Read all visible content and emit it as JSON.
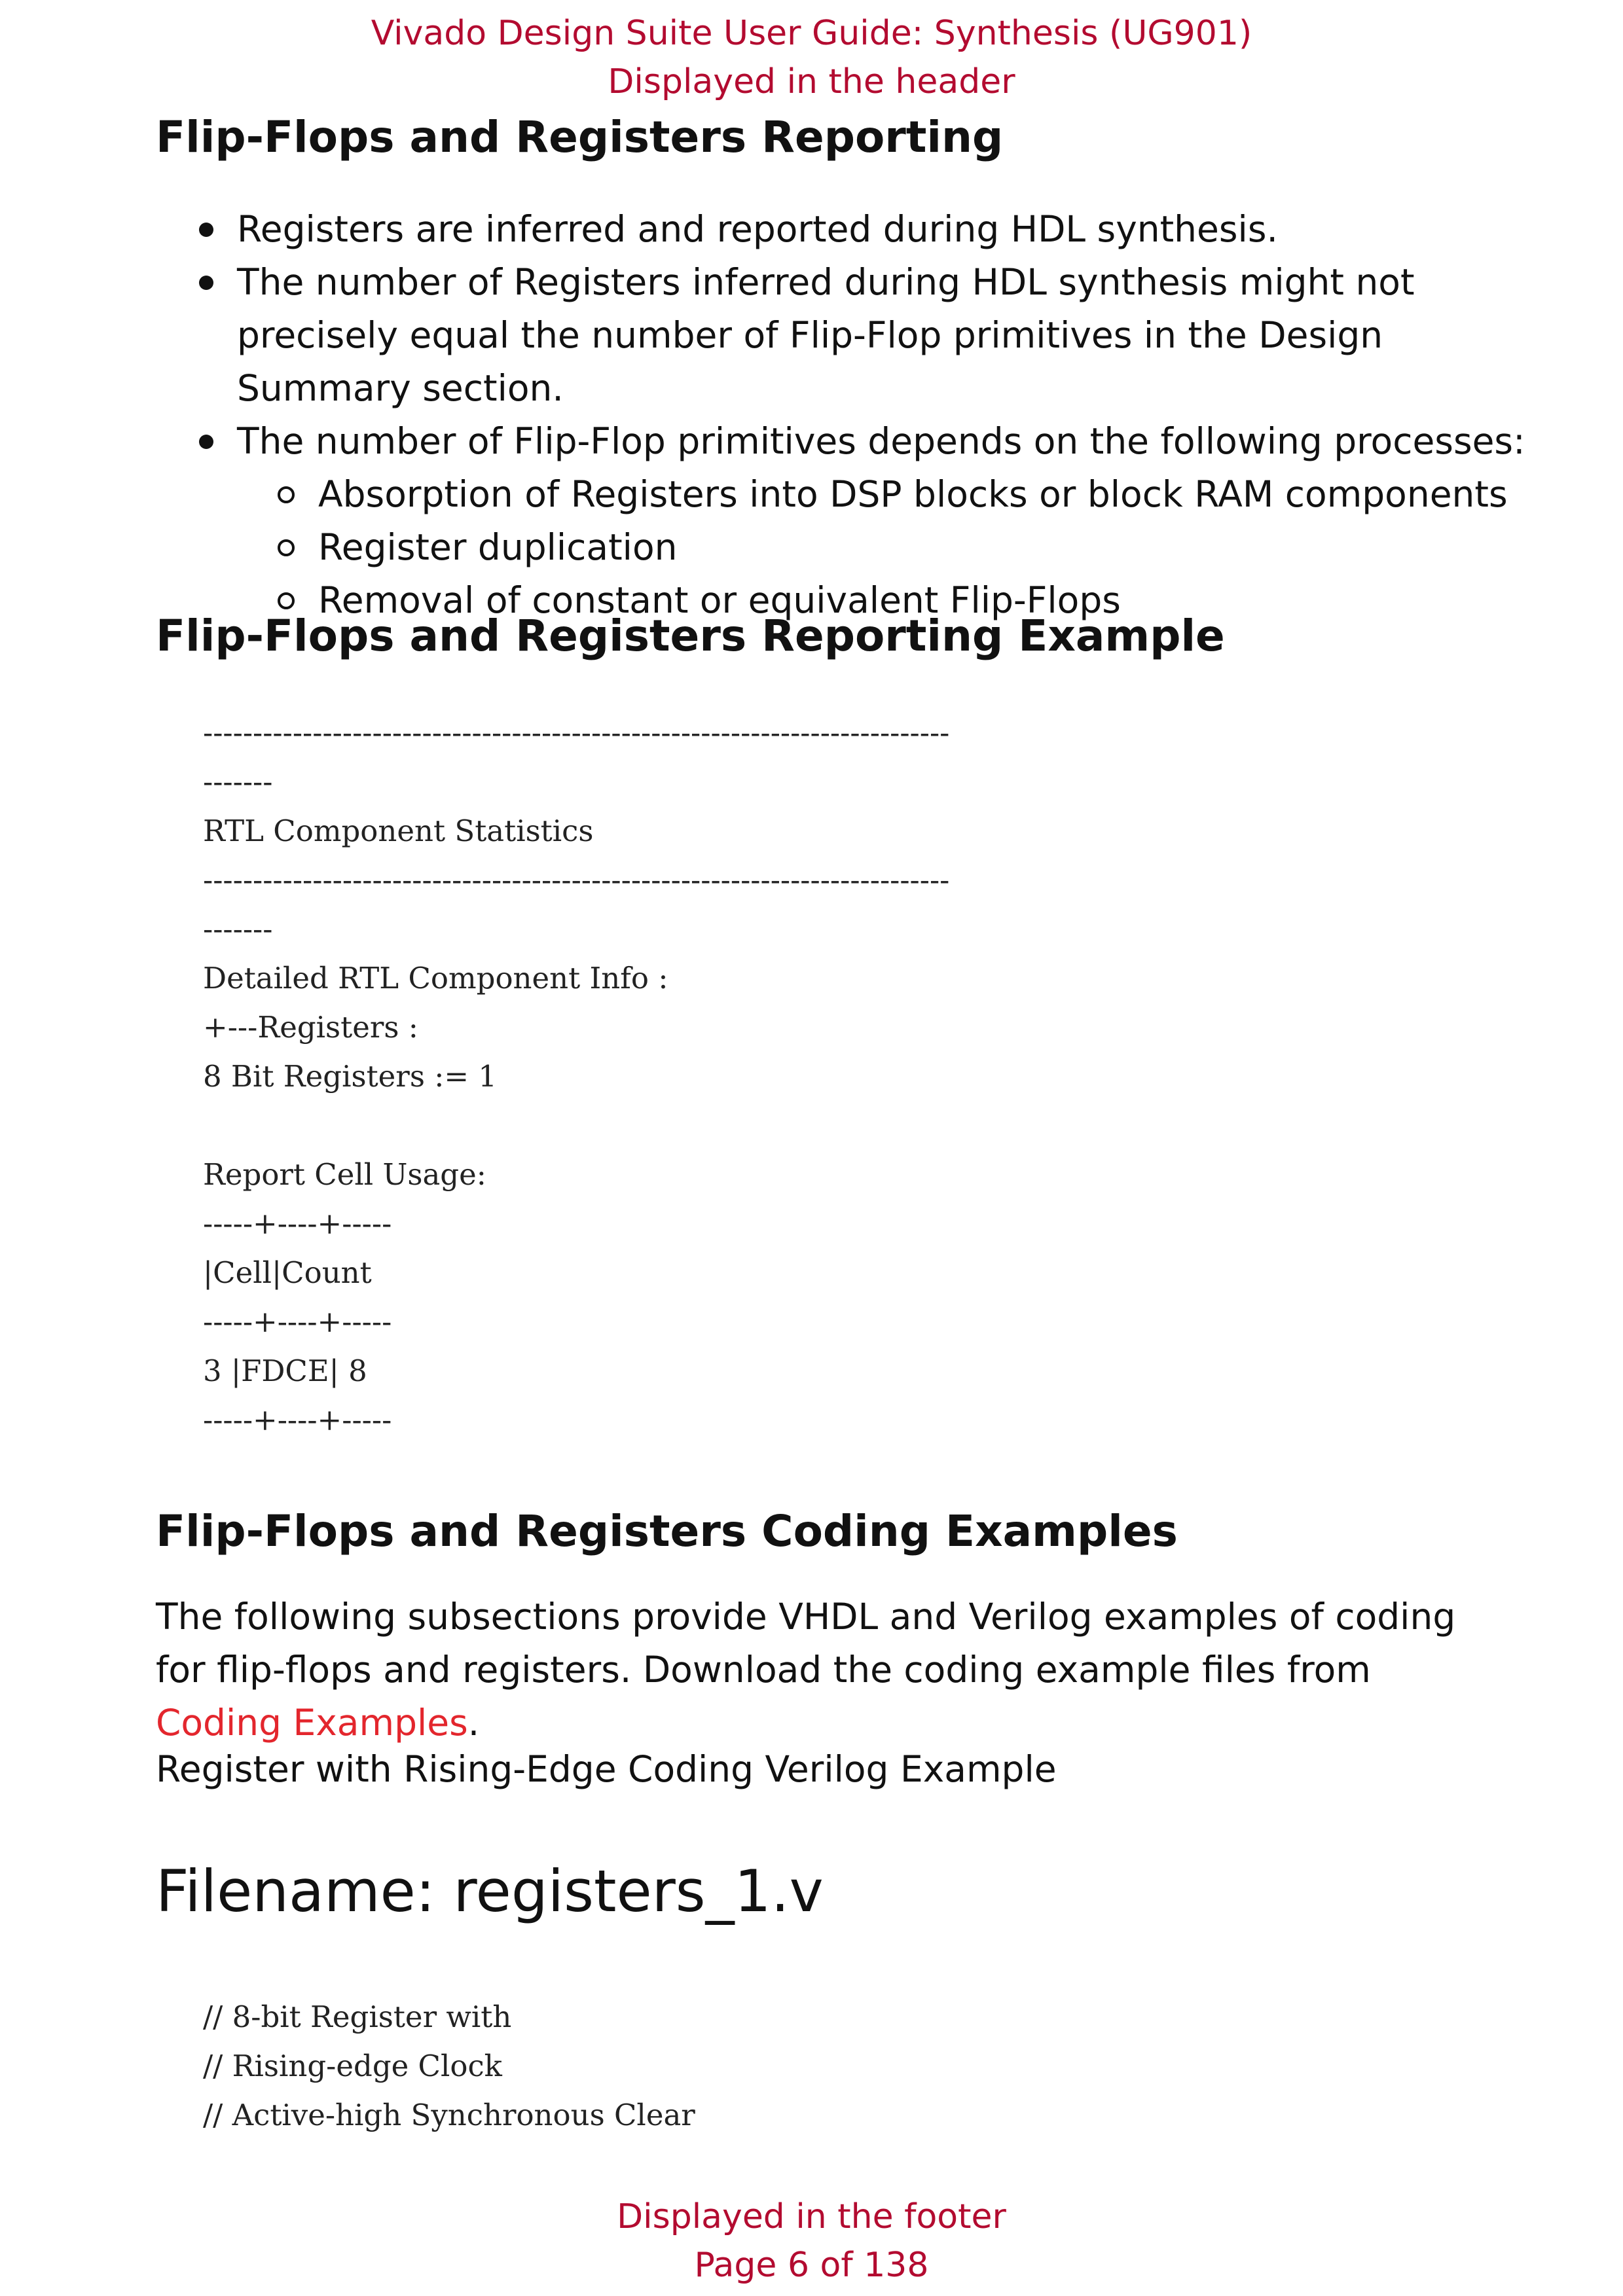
{
  "header": {
    "line1": "Vivado Design Suite User Guide: Synthesis (UG901)",
    "line2": "Displayed in the header"
  },
  "section1": {
    "title": "Flip-Flops and Registers Reporting",
    "bullets": [
      "Registers are inferred and reported during HDL synthesis.",
      "The number of Registers inferred during HDL synthesis might not precisely equal the number of Flip-Flop primitives in the Design Summary section.",
      "The number of Flip-Flop primitives depends on the following processes:"
    ],
    "sub_bullets": [
      "Absorption of Registers into DSP blocks or block RAM components",
      "Register duplication",
      "Removal of constant or equivalent Flip-Flops"
    ]
  },
  "section2": {
    "title": "Flip-Flops and Registers Reporting Example",
    "code": "---------------------------------------------------------------------------\n-------\nRTL Component Statistics\n---------------------------------------------------------------------------\n-------\nDetailed RTL Component Info :\n+---Registers :\n8 Bit Registers := 1\n\nReport Cell Usage:\n-----+----+-----\n|Cell|Count\n-----+----+-----\n3 |FDCE| 8\n-----+----+-----"
  },
  "section3": {
    "title": "Flip-Flops and Registers Coding Examples",
    "para_text": "The following subsections provide VHDL and Verilog examples of coding for flip-flops and registers. Download the coding example files from ",
    "link_text": "Coding Examples",
    "para_end": ".",
    "example_label": "Register with Rising-Edge Coding Verilog Example",
    "filename": "Filename: registers_1.v",
    "code": "// 8-bit Register with\n// Rising-edge Clock\n// Active-high Synchronous Clear"
  },
  "footer": {
    "line1": "Displayed in the footer",
    "line2": "Page 6 of 138"
  },
  "colors": {
    "header_footer": "#b30b30",
    "link": "#e3262d"
  }
}
